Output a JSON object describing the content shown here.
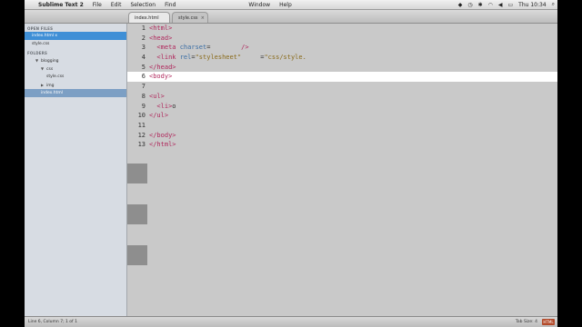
{
  "menubar": {
    "app": "Sublime Text 2",
    "items": [
      "File",
      "Edit",
      "Selection",
      "Find",
      "Window",
      "Help"
    ],
    "clock": "Thu 10:34"
  },
  "tabs": [
    {
      "label": "index.html x",
      "active": true
    },
    {
      "label": "style.css",
      "active": false
    }
  ],
  "sidebar": {
    "open_files_header": "OPEN FILES",
    "open_files": [
      "index.html x",
      "style.css"
    ],
    "folders_header": "FOLDERS",
    "tree": [
      {
        "label": "blogging",
        "level": 1,
        "state": "open"
      },
      {
        "label": "css",
        "level": 2,
        "state": "open"
      },
      {
        "label": "style.css",
        "level": 3,
        "state": "leaf"
      },
      {
        "label": "img",
        "level": 2,
        "state": "closed"
      },
      {
        "label": "index.html",
        "level": 2,
        "state": "leaf"
      }
    ]
  },
  "editor": {
    "line_numbers": [
      "1",
      "2",
      "3",
      "4",
      "5",
      "6",
      "7",
      "8",
      "9",
      "10",
      "11",
      "12",
      "13"
    ],
    "lines": [
      [
        {
          "t": "<html>",
          "c": "tag"
        }
      ],
      [
        {
          "t": "<head>",
          "c": "tag"
        }
      ],
      [
        {
          "t": "  <meta ",
          "c": "tag"
        },
        {
          "t": "charset",
          "c": "attr"
        },
        {
          "t": "=",
          "c": ""
        },
        {
          "t": "       ",
          "c": "str"
        },
        {
          "t": " />",
          "c": "tag"
        }
      ],
      [
        {
          "t": "  <link ",
          "c": "tag"
        },
        {
          "t": "rel",
          "c": "attr"
        },
        {
          "t": "=",
          "c": ""
        },
        {
          "t": "\"stylesheet\"",
          "c": "str"
        },
        {
          "t": "     ",
          "c": "attr"
        },
        {
          "t": "=",
          "c": ""
        },
        {
          "t": "\"css/style.",
          "c": "str"
        }
      ],
      [
        {
          "t": "</head>",
          "c": "tag"
        }
      ],
      [
        {
          "t": "<body>",
          "c": "tag"
        }
      ],
      [],
      [
        {
          "t": "<ul>",
          "c": "tag"
        }
      ],
      [
        {
          "t": "  <li>",
          "c": "tag"
        },
        {
          "t": "o",
          "c": ""
        }
      ],
      [
        {
          "t": "</ul>",
          "c": "tag"
        }
      ],
      [],
      [
        {
          "t": "</body>",
          "c": "tag"
        }
      ],
      [
        {
          "t": "</html>",
          "c": "tag"
        }
      ]
    ],
    "current_line": 6
  },
  "status": {
    "left": "Line 6, Column 7",
    "middle": "1 of 1",
    "right": "Tab Size: 4",
    "badge": "HTML"
  }
}
